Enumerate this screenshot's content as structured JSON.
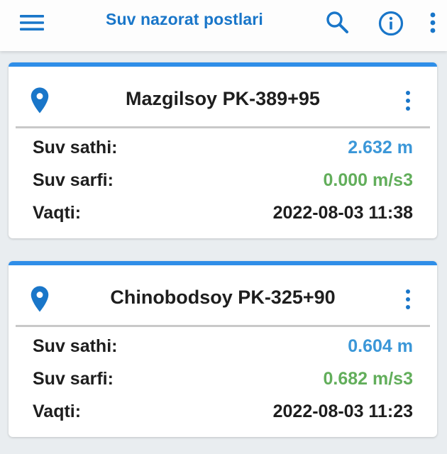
{
  "appbar": {
    "title": "Suv nazorat postlari",
    "accent_color": "#1976c9",
    "icons": [
      "menu-icon",
      "search-icon",
      "info-icon",
      "more-vertical-icon"
    ]
  },
  "stations": [
    {
      "name": "Mazgilsoy PK-389+95",
      "level_label": "Suv sathi:",
      "level_value": "2.632 m",
      "flow_label": "Suv sarfi:",
      "flow_value": "0.000 m/s3",
      "time_label": "Vaqti:",
      "time_value": "2022-08-03 11:38"
    },
    {
      "name": "Chinobodsoy PK-325+90",
      "level_label": "Suv sathi:",
      "level_value": "0.604 m",
      "flow_label": "Suv sarfi:",
      "flow_value": "0.682 m/s3",
      "time_label": "Vaqti:",
      "time_value": "2022-08-03 11:23"
    }
  ],
  "colors": {
    "card_accent": "#2f8ee8",
    "level_value": "#3b97d8",
    "flow_value": "#62ae5b",
    "background": "#e9edf0"
  }
}
